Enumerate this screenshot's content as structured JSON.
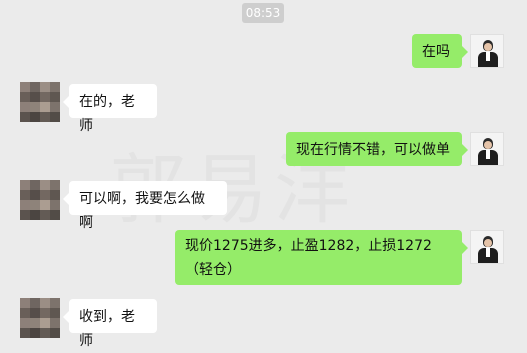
{
  "header": {
    "time": "08:53"
  },
  "watermark": "郭易洋",
  "messages": [
    {
      "sender": "self",
      "text": "在吗"
    },
    {
      "sender": "other",
      "text": "在的，老师"
    },
    {
      "sender": "self",
      "text": "现在行情不错，可以做单"
    },
    {
      "sender": "other",
      "text": "可以啊，我要怎么做啊"
    },
    {
      "sender": "self",
      "text": "现价1275进多，止盈1282，止损1272（轻仓）"
    },
    {
      "sender": "other",
      "text": "收到，老师"
    }
  ]
}
